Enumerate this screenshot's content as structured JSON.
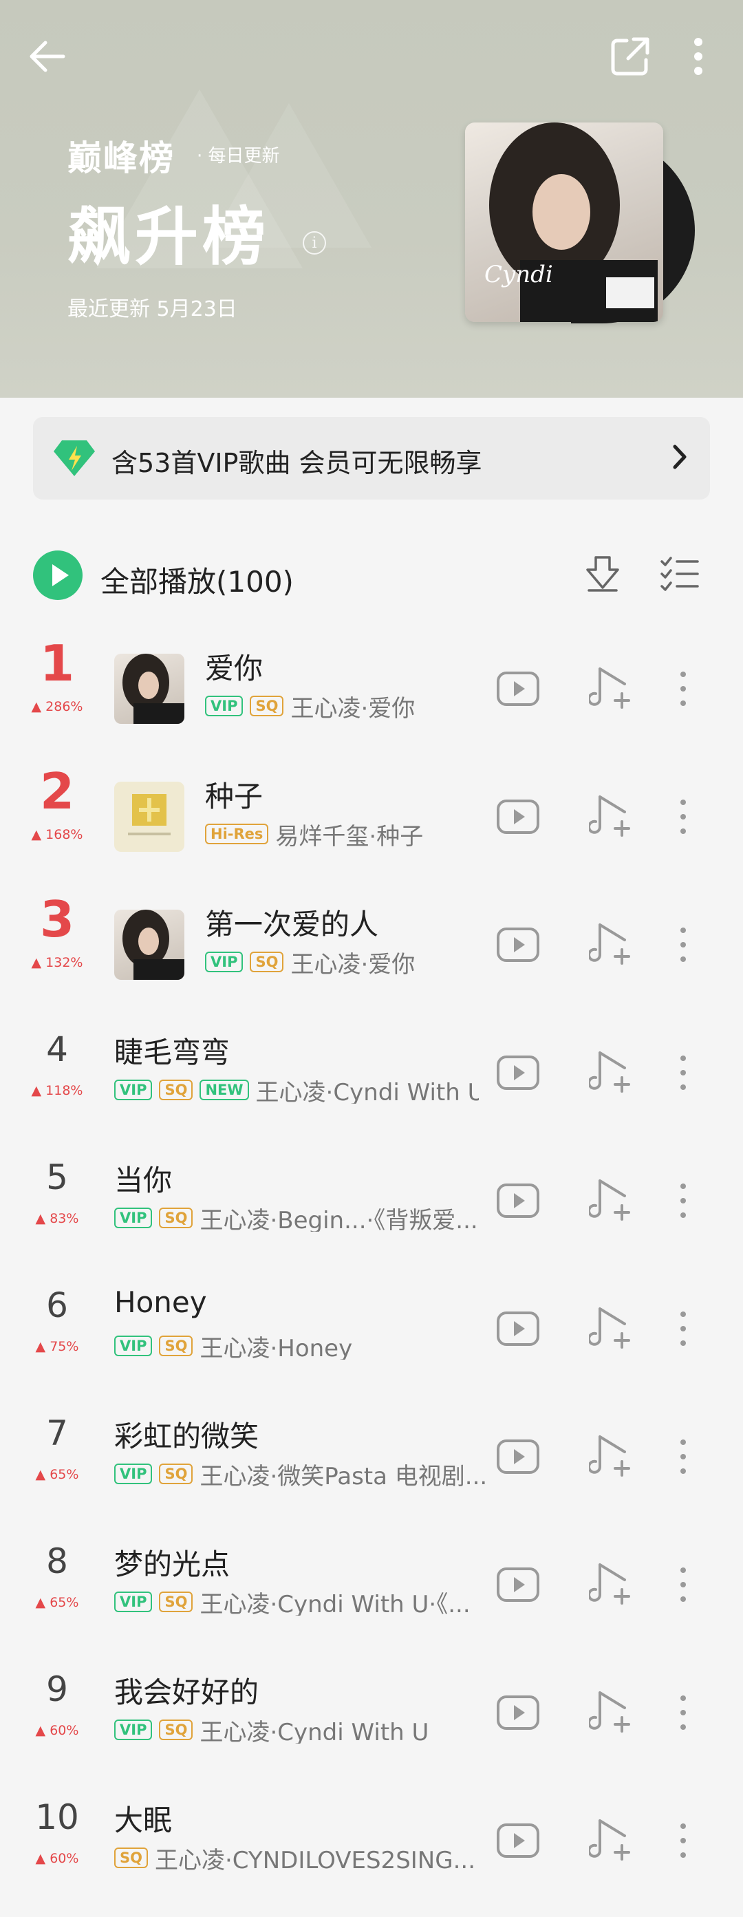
{
  "header": {
    "brand": "巅峰榜",
    "brand_sub": "· 每日更新",
    "title": "飙升榜",
    "updated": "最近更新 5月23日",
    "info_glyph": "i",
    "album_text": "Cyndi"
  },
  "vip_banner": {
    "text": "含53首VIP歌曲 会员可无限畅享"
  },
  "play_all": {
    "label": "全部播放(100)"
  },
  "songs": [
    {
      "rank": "1",
      "trend": "286%",
      "title": "爱你",
      "artist": "王心凌·爱你"
    },
    {
      "rank": "2",
      "trend": "168%",
      "title": "种子",
      "artist": "易烊千玺·种子"
    },
    {
      "rank": "3",
      "trend": "132%",
      "title": "第一次爱的人",
      "artist": "王心凌·爱你"
    },
    {
      "rank": "4",
      "trend": "118%",
      "title": "睫毛弯弯",
      "artist": "王心凌·Cyndi With U"
    },
    {
      "rank": "5",
      "trend": "83%",
      "title": "当你",
      "artist": "王心凌·Begin...·《背叛爱..."
    },
    {
      "rank": "6",
      "trend": "75%",
      "title": "Honey",
      "artist": "王心凌·Honey"
    },
    {
      "rank": "7",
      "trend": "65%",
      "title": "彩虹的微笑",
      "artist": "王心凌·微笑Pasta 电视剧..."
    },
    {
      "rank": "8",
      "trend": "65%",
      "title": "梦的光点",
      "artist": "王心凌·Cyndi With U·《..."
    },
    {
      "rank": "9",
      "trend": "60%",
      "title": "我会好好的",
      "artist": "王心凌·Cyndi With U"
    },
    {
      "rank": "10",
      "trend": "60%",
      "title": "大眠",
      "artist": "王心凌·CYNDILOVES2SING..."
    }
  ],
  "tags": {
    "vip": "VIP",
    "sq": "SQ",
    "new": "NEW",
    "hires": "Hi-Res"
  },
  "colors": {
    "accent_green": "#31c27c",
    "trend_red": "#e4484a",
    "sq_gold": "#e0a33a"
  },
  "icons": [
    "back-arrow-icon",
    "share-icon",
    "more-vertical-icon",
    "diamond-icon",
    "chevron-right-icon",
    "play-circle-icon",
    "download-icon",
    "multi-select-icon",
    "mv-play-icon",
    "add-to-playlist-icon"
  ]
}
